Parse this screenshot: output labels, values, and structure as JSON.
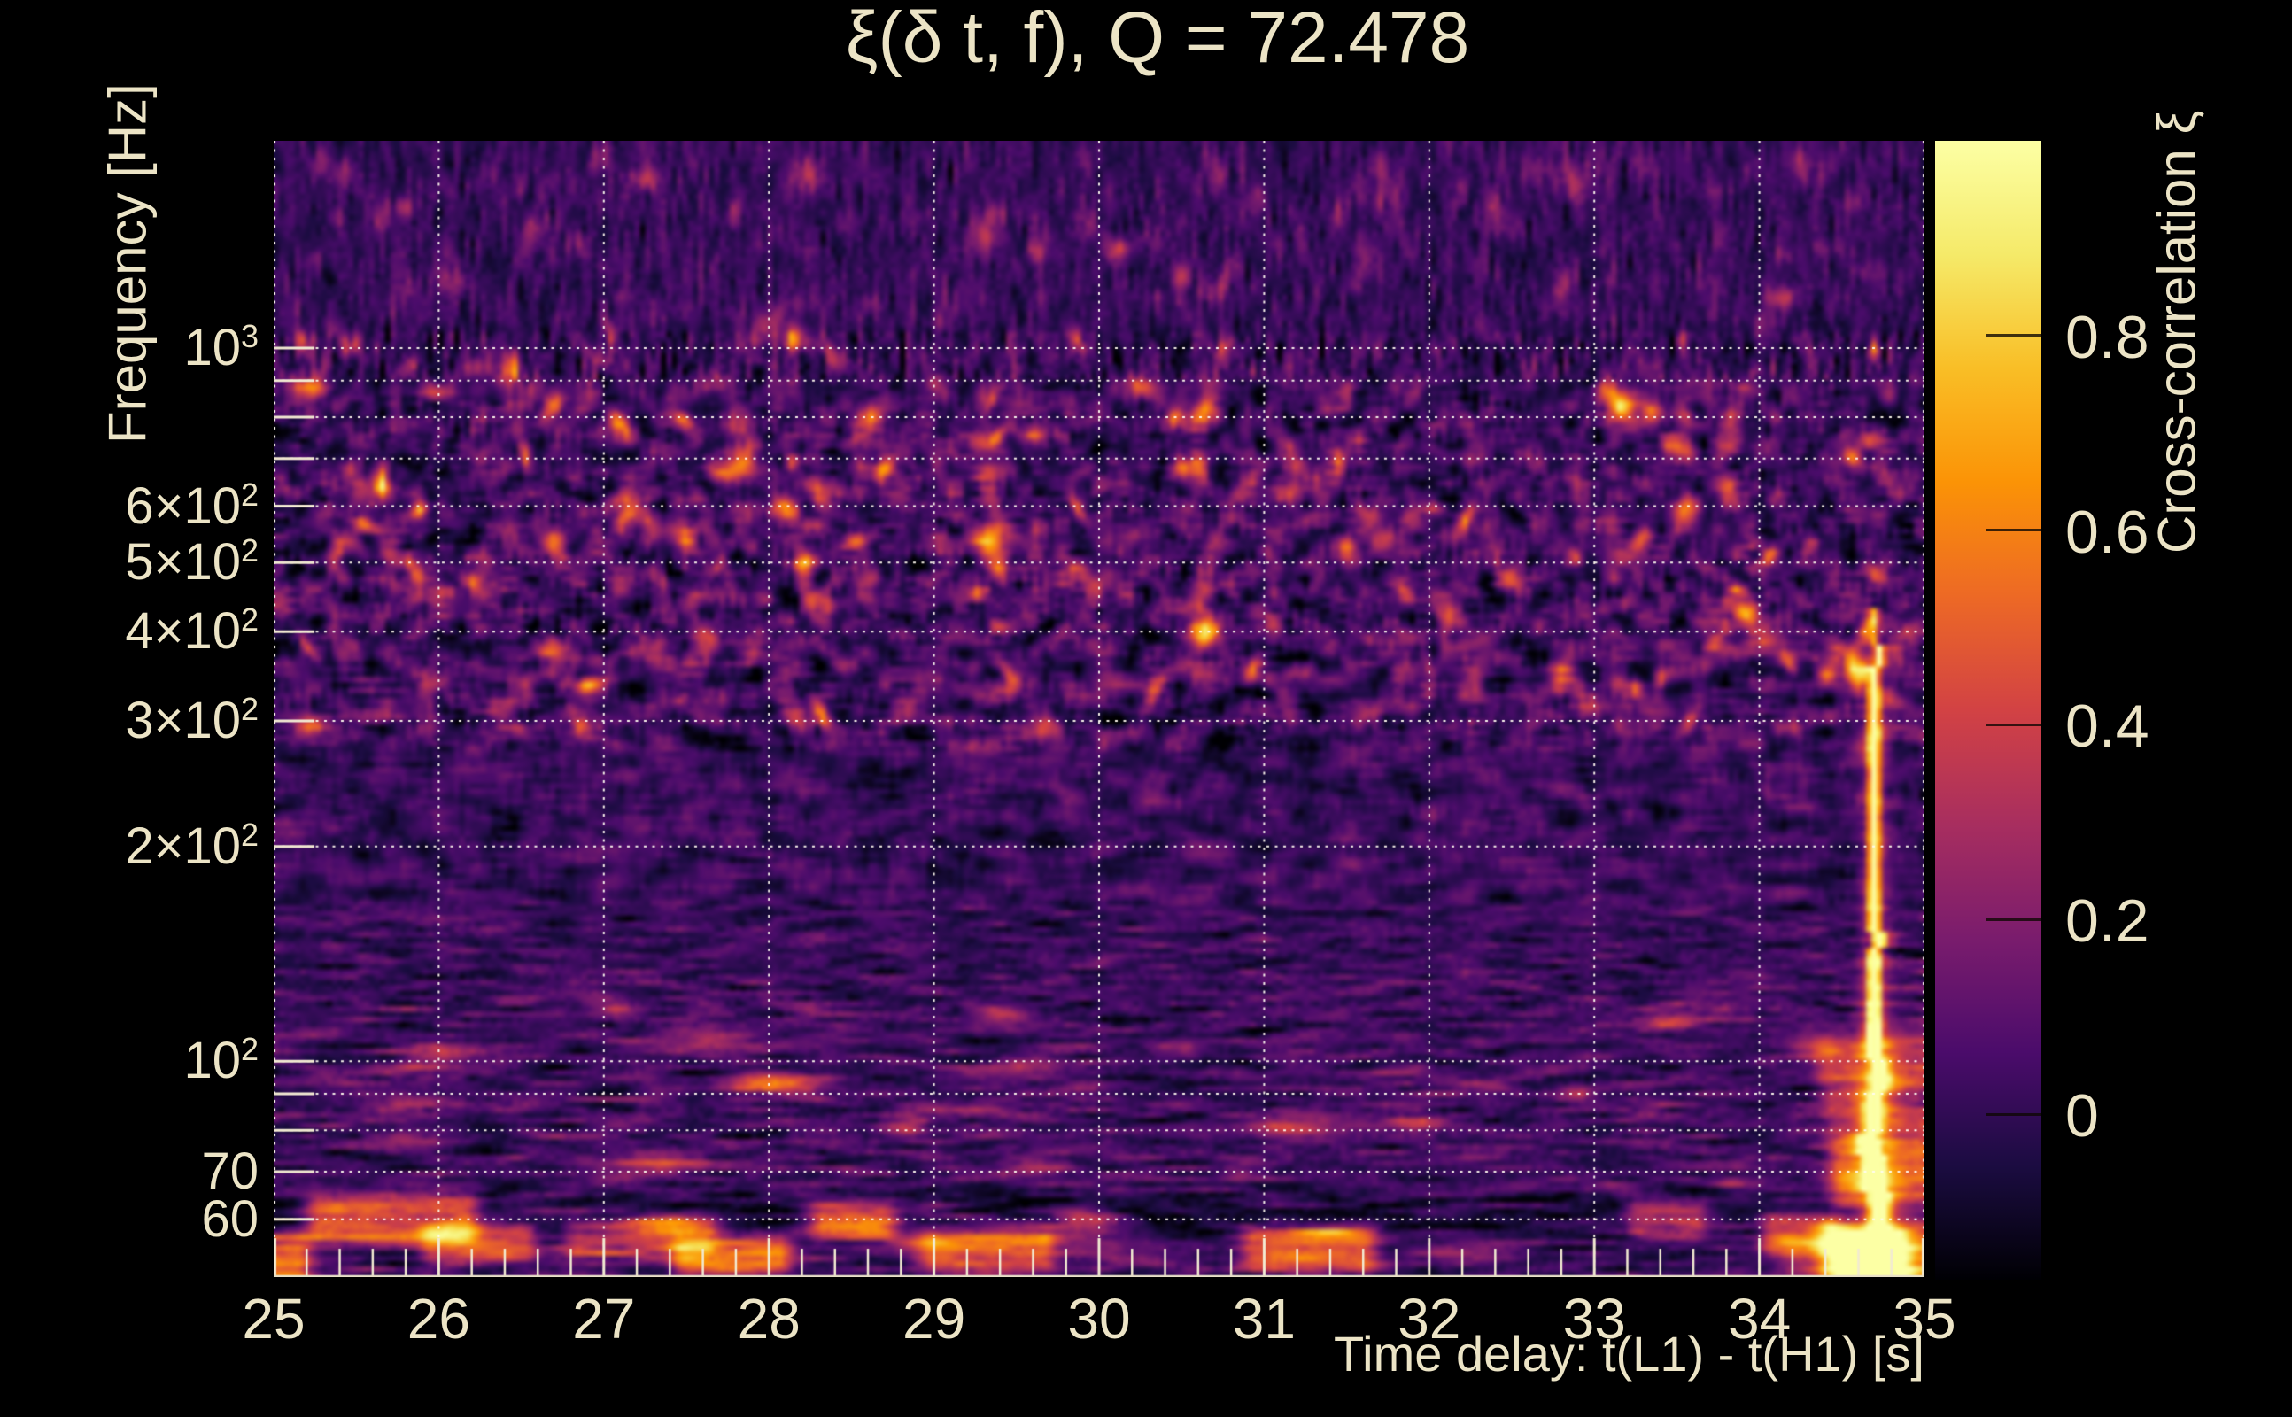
{
  "chart_data": {
    "type": "heatmap",
    "title": "ξ(δ t, f), Q = 72.478",
    "xlabel": "Time delay: t(L1) - t(H1) [s]",
    "ylabel": "Frequency [Hz]",
    "x_axis": {
      "min": 25,
      "max": 35,
      "ticks": [
        25,
        26,
        27,
        28,
        29,
        30,
        31,
        32,
        33,
        34,
        35
      ],
      "minor_step": 0.2,
      "grid": "dotted-white-on-majors"
    },
    "y_axis": {
      "scale": "log",
      "min": 49.8,
      "max": 1952,
      "gridlines": [
        1000,
        900,
        800,
        700,
        600,
        500,
        400,
        300,
        200,
        100,
        90,
        80,
        70,
        60
      ],
      "labeled_ticks": [
        {
          "f": 1000,
          "text": "10",
          "sup": "3"
        },
        {
          "f": 600,
          "text": "6×10",
          "sup": "2"
        },
        {
          "f": 500,
          "text": "5×10",
          "sup": "2"
        },
        {
          "f": 400,
          "text": "4×10",
          "sup": "2"
        },
        {
          "f": 300,
          "text": "3×10",
          "sup": "2"
        },
        {
          "f": 200,
          "text": "2×10",
          "sup": "2"
        },
        {
          "f": 100,
          "text": "10",
          "sup": "2"
        },
        {
          "f": 70,
          "text": "70",
          "sup": ""
        },
        {
          "f": 60,
          "text": "60",
          "sup": ""
        }
      ]
    },
    "colorbar": {
      "label": "Cross-correlation ξ",
      "vmin": -0.17,
      "vmax": 1.0,
      "ticks": [
        {
          "value": 0.8,
          "label": "0.8"
        },
        {
          "value": 0.6,
          "label": "0.6"
        },
        {
          "value": 0.4,
          "label": "0.4"
        },
        {
          "value": 0.2,
          "label": "0.2"
        },
        {
          "value": 0,
          "label": "0"
        }
      ]
    },
    "colormap": {
      "name": "inferno",
      "stops": [
        [
          0.0,
          0,
          0,
          4
        ],
        [
          0.1,
          27,
          12,
          65
        ],
        [
          0.2,
          75,
          12,
          107
        ],
        [
          0.3,
          122,
          28,
          109
        ],
        [
          0.4,
          168,
          46,
          95
        ],
        [
          0.5,
          210,
          66,
          68
        ],
        [
          0.6,
          237,
          105,
          37
        ],
        [
          0.7,
          251,
          147,
          6
        ],
        [
          0.8,
          249,
          190,
          38
        ],
        [
          0.9,
          245,
          234,
          105
        ],
        [
          1.0,
          252,
          255,
          164
        ]
      ]
    },
    "style": {
      "background": "#000000",
      "text_color": "#ece4c6",
      "grid_color": "rgba(255,251,240,0.95)",
      "tick_color": "#f2ead2"
    },
    "noise": {
      "seed": 1337,
      "grid": [
        311,
        214
      ],
      "base_bands": [
        {
          "fmin": 1060,
          "base": 0.012,
          "sigma": 0.05
        },
        {
          "fmin": 520,
          "base": 0.03,
          "sigma": 0.08
        },
        {
          "fmin": 270,
          "base": 0.032,
          "sigma": 0.088
        },
        {
          "fmin": 135,
          "base": 0.02,
          "sigma": 0.058
        },
        {
          "fmin": 0,
          "base": 0.03,
          "sigma": 0.065
        }
      ],
      "speckles_mid": {
        "count": 340,
        "fmin": 290,
        "fmax": 1070,
        "amp_base": 0.1,
        "amp_var": 0.5
      },
      "speckles_top": {
        "count": 150,
        "fmin": 1060,
        "fmax": 1850,
        "amp_base": 0.05,
        "amp_var": 0.2
      },
      "blobs_low": {
        "count": 70,
        "fmin": 52,
        "fmax": 120,
        "amp_base": 0.06,
        "amp_var": 0.3
      }
    },
    "features": {
      "dark_bands": [
        [
          25,
          35,
          58.5,
          63.5,
          -0.095
        ],
        [
          25,
          35,
          940,
          1060,
          -0.03
        ]
      ],
      "streaks": [
        [
          25.28,
          26.15,
          57,
          63,
          0.52
        ],
        [
          25.98,
          26.5,
          53.5,
          57.5,
          0.42
        ],
        [
          26.85,
          27.6,
          54.5,
          58.5,
          0.36
        ],
        [
          27.5,
          28.05,
          51.5,
          55,
          0.5
        ],
        [
          28.33,
          28.68,
          58,
          62,
          0.42
        ],
        [
          29.0,
          29.65,
          52,
          56.5,
          0.45
        ],
        [
          30.95,
          31.6,
          52,
          57,
          0.45
        ],
        [
          33.28,
          33.6,
          58,
          62,
          0.38
        ],
        [
          34.1,
          34.42,
          55,
          60,
          0.42
        ],
        [
          25.0,
          25.14,
          50,
          56,
          0.5
        ],
        [
          34.42,
          35.0,
          96,
          106,
          0.34
        ],
        [
          34.45,
          35.0,
          87,
          93,
          0.3
        ],
        [
          34.5,
          35.0,
          78,
          83,
          0.3
        ],
        [
          34.5,
          35.0,
          70,
          75,
          0.4
        ],
        [
          34.52,
          35.0,
          63.5,
          67.5,
          0.45
        ],
        [
          34.45,
          35.0,
          49.5,
          58,
          0.6
        ],
        [
          34.58,
          34.82,
          50,
          56.5,
          0.55
        ],
        [
          34.2,
          34.5,
          50,
          56,
          0.25
        ]
      ],
      "extra_speckles": [
        [
          34.7,
          480,
          0.5
        ],
        [
          34.56,
          700,
          0.4
        ],
        [
          34.66,
          745,
          0.45
        ],
        [
          29.62,
          760,
          0.5
        ],
        [
          30.25,
          880,
          0.45
        ],
        [
          26.2,
          470,
          0.5
        ],
        [
          33.9,
          430,
          0.45
        ],
        [
          28.3,
          640,
          0.45
        ],
        [
          31.5,
          530,
          0.42
        ]
      ],
      "chirp": {
        "track": [
          [
            430,
            34.71
          ],
          [
            400,
            34.695
          ],
          [
            370,
            34.72
          ],
          [
            340,
            34.7
          ],
          [
            310,
            34.685
          ],
          [
            280,
            34.705
          ],
          [
            255,
            34.69
          ],
          [
            230,
            34.71
          ],
          [
            205,
            34.695
          ],
          [
            185,
            34.68
          ],
          [
            165,
            34.7
          ],
          [
            148,
            34.715
          ],
          [
            132,
            34.695
          ],
          [
            118,
            34.68
          ],
          [
            106,
            34.7
          ],
          [
            95,
            34.72
          ],
          [
            85,
            34.695
          ],
          [
            76,
            34.67
          ],
          [
            68,
            34.7
          ],
          [
            61,
            34.73
          ],
          [
            55,
            34.7
          ],
          [
            50,
            34.68
          ]
        ],
        "f_faint": 380,
        "f_mid": 320,
        "amp_faint": 0.45,
        "amp_mid": 0.85,
        "amp_core": 1.15,
        "halo_mult": 0.33,
        "halo_widen": 2.6
      }
    }
  }
}
